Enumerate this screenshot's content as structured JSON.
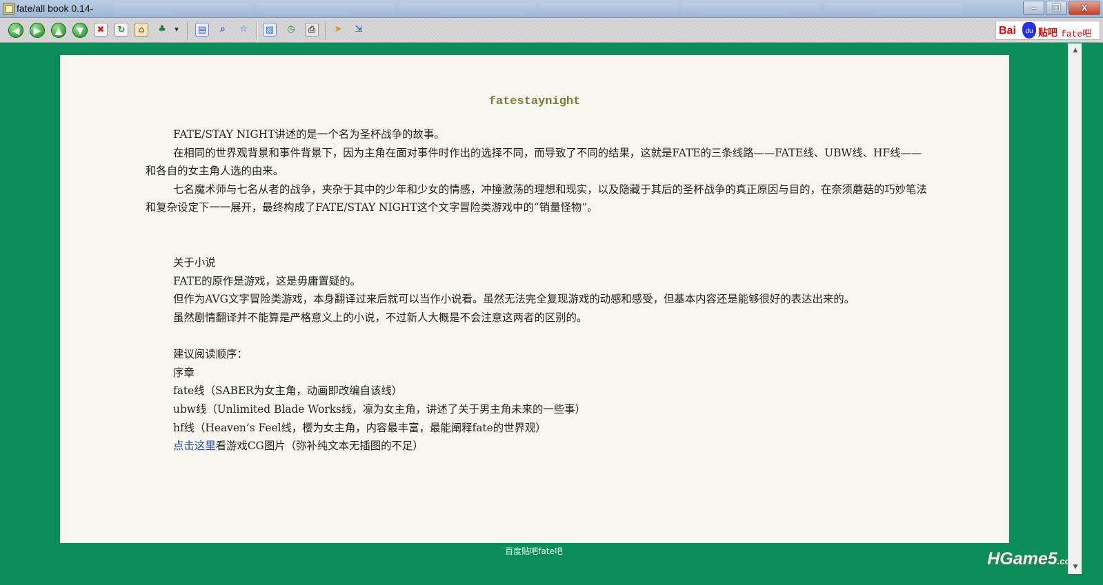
{
  "window": {
    "title": "fate/all book 0.14-",
    "minimize": "–",
    "restore": "❐",
    "close": "X"
  },
  "toolbar": {
    "icons": {
      "back": "◀",
      "forward": "▶",
      "up": "▲",
      "down": "▼",
      "stop": "✖",
      "refresh": "↻",
      "home": "⌂",
      "tree": "♣",
      "dropdown": "▾",
      "panel": "▤",
      "search": "⌕",
      "favorites": "☆",
      "image": "▧",
      "history": "◷",
      "print": "⎙",
      "pointer": "➤",
      "exit": "⇲"
    },
    "baidu": {
      "logo_text": "Bai",
      "paw_text": "du",
      "tieba": "贴吧",
      "forum": "fate吧"
    }
  },
  "document": {
    "title": "fatestaynight",
    "p1": "FATE/STAY NIGHT讲述的是一个名为圣杯战争的故事。",
    "p2": "在相同的世界观背景和事件背景下，因为主角在面对事件时作出的选择不同，而导致了不同的结果，这就是FATE的三条线路——FATE线、UBW线、HF线——和各自的女主角人选的由来。",
    "p3": "七名魔术师与七名从者的战争，夹杂于其中的少年和少女的情感，冲撞激荡的理想和现实，以及隐藏于其后的圣杯战争的真正原因与目的，在奈须蘑菇的巧妙笔法和复杂设定下一一展开，最终构成了FATE/STAY NIGHT这个文字冒险类游戏中的“销量怪物”。",
    "about_heading": "关于小说",
    "p4": "FATE的原作是游戏，这是毋庸置疑的。",
    "p5": "但作为AVG文字冒险类游戏，本身翻译过来后就可以当作小说看。虽然无法完全复现游戏的动感和感受，但基本内容还是能够很好的表达出来的。",
    "p6": "虽然剧情翻译并不能算是严格意义上的小说，不过新人大概是不会注意这两者的区别的。",
    "order_heading": "建议阅读顺序：",
    "order1": "序章",
    "order2": "fate线（SABER为女主角，动画即改编自该线）",
    "order3": "ubw线（Unlimited Blade Works线，凛为女主角，讲述了关于男主角未来的一些事）",
    "order4": "hf线（Heaven’s Feel线，樱为女主角，内容最丰富，最能阐释fate的世界观）",
    "link_text": "点击这里",
    "link_suffix": "看游戏CG图片（弥补纯文本无插图的不足）"
  },
  "footer": {
    "text": "百度贴吧fate吧"
  },
  "watermark": {
    "main": "HGame5",
    "suffix": ".com"
  },
  "scrollbar": {
    "up": "▲",
    "down": "▼"
  },
  "colors": {
    "background": "#0b8d5a",
    "page": "#f6f6ee",
    "title": "#7a7a3a",
    "link": "#2a4db5"
  }
}
